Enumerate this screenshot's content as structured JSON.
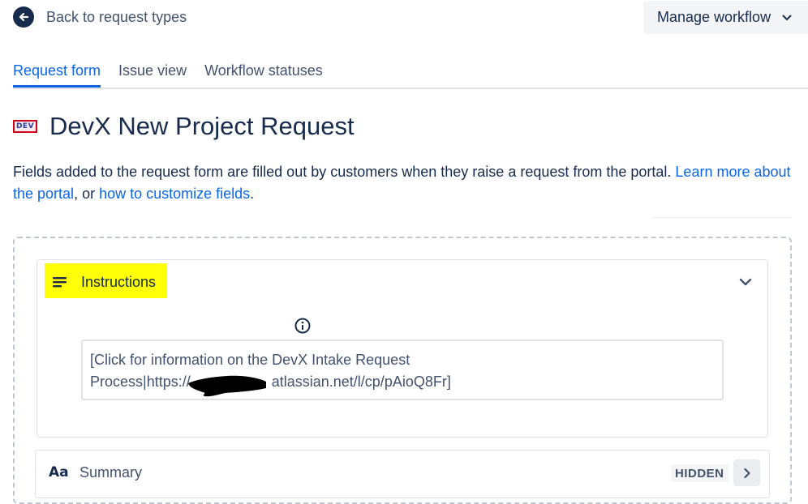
{
  "header": {
    "back_label": "Back to request types",
    "manage_label": "Manage workflow"
  },
  "tabs": [
    {
      "label": "Request form",
      "active": true
    },
    {
      "label": "Issue view",
      "active": false
    },
    {
      "label": "Workflow statuses",
      "active": false
    }
  ],
  "page": {
    "badge_text": "DEV",
    "title": "DevX New Project Request",
    "description": {
      "text1": "Fields added to the request form are filled out by customers when they raise a request from the portal. ",
      "link1": "Learn more about the portal",
      "text2": ", or ",
      "link2": "how to customize fields",
      "text3": "."
    }
  },
  "instructions": {
    "label": "Instructions",
    "text_line1": "[Click for information on the DevX Intake Request",
    "text_line2_prefix": "Process|https://",
    "text_line2_suffix": "atlassian.net/l/cp/pAioQ8Fr]"
  },
  "summary": {
    "icon_text": "Aa",
    "label": "Summary",
    "badge": "HIDDEN"
  },
  "colors": {
    "accent": "#0c66e4",
    "text": "#172b4d",
    "highlight": "#ffff0a"
  }
}
